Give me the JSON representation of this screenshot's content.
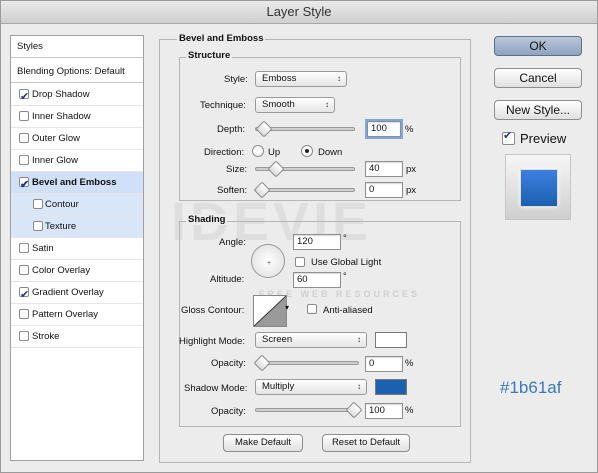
{
  "window": {
    "title": "Layer Style"
  },
  "styles_list": {
    "header": "Styles",
    "blending": "Blending Options: Default",
    "items": [
      {
        "label": "Drop Shadow",
        "checked": true
      },
      {
        "label": "Inner Shadow",
        "checked": false
      },
      {
        "label": "Outer Glow",
        "checked": false
      },
      {
        "label": "Inner Glow",
        "checked": false
      },
      {
        "label": "Bevel and Emboss",
        "checked": true,
        "selected": true
      },
      {
        "label": "Contour",
        "checked": false,
        "sub": true
      },
      {
        "label": "Texture",
        "checked": false,
        "sub": true
      },
      {
        "label": "Satin",
        "checked": false
      },
      {
        "label": "Color Overlay",
        "checked": false
      },
      {
        "label": "Gradient Overlay",
        "checked": true
      },
      {
        "label": "Pattern Overlay",
        "checked": false
      },
      {
        "label": "Stroke",
        "checked": false
      }
    ]
  },
  "bevel": {
    "title": "Bevel and Emboss",
    "structure": {
      "title": "Structure",
      "style_label": "Style:",
      "style_value": "Emboss",
      "technique_label": "Technique:",
      "technique_value": "Smooth",
      "depth_label": "Depth:",
      "depth_value": "100",
      "depth_unit": "%",
      "depth_slider": 0.02,
      "direction_label": "Direction:",
      "dir_up": "Up",
      "dir_down": "Down",
      "size_label": "Size:",
      "size_value": "40",
      "size_unit": "px",
      "size_slider": 0.16,
      "soften_label": "Soften:",
      "soften_value": "0",
      "soften_unit": "px",
      "soften_slider": 0.0
    },
    "shading": {
      "title": "Shading",
      "angle_label": "Angle:",
      "angle_value": "120",
      "angle_unit": "°",
      "global_light": "Use Global Light",
      "altitude_label": "Altitude:",
      "altitude_value": "60",
      "altitude_unit": "°",
      "gloss_label": "Gloss Contour:",
      "anti_aliased": "Anti-aliased",
      "highlight_label": "Highlight Mode:",
      "highlight_mode": "Screen",
      "highlight_color": "#ffffff",
      "opacity_label": "Opacity:",
      "highlight_opacity": "0",
      "highlight_opacity_unit": "%",
      "highlight_slider": 0.0,
      "shadow_label": "Shadow Mode:",
      "shadow_mode": "Multiply",
      "shadow_color": "#1b61af",
      "shadow_opacity_label": "Opacity:",
      "shadow_opacity": "100",
      "shadow_opacity_unit": "%",
      "shadow_slider": 1.0
    },
    "make_default": "Make Default",
    "reset_default": "Reset to Default"
  },
  "actions": {
    "ok": "OK",
    "cancel": "Cancel",
    "new_style": "New Style...",
    "preview": "Preview"
  },
  "color_caption": "#1b61af",
  "watermark": {
    "main": "IDEVIE",
    "sub": "FREE WEB RESOURCES"
  }
}
